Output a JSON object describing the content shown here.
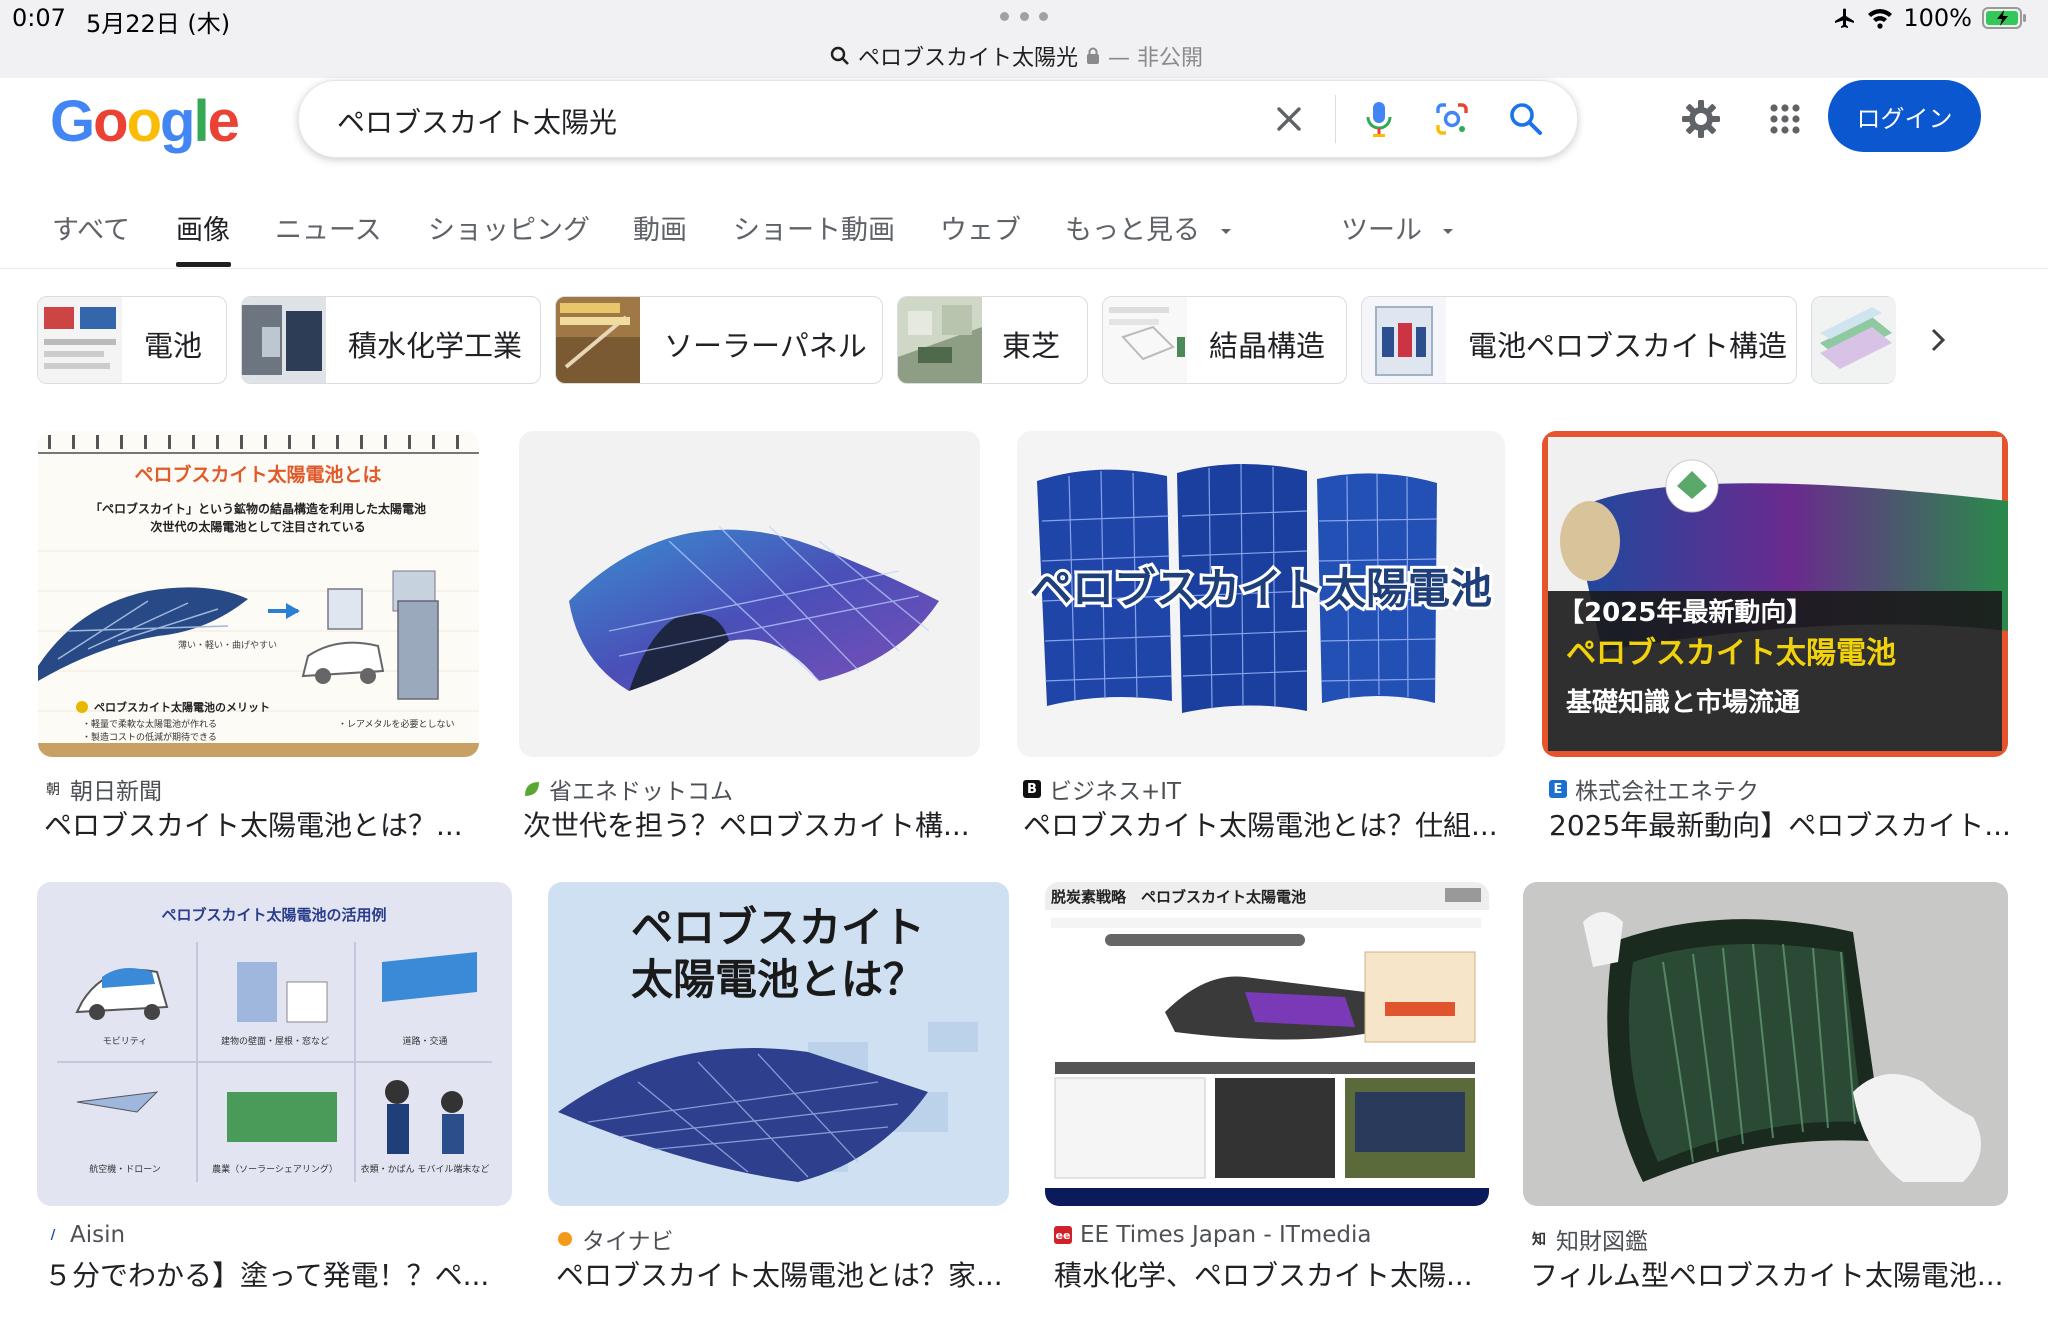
{
  "status_bar": {
    "time": "0:07",
    "date": "5月22日 (木)",
    "url_text": "ペロブスカイト太陽光",
    "private_label": "— 非公開",
    "battery": "100%"
  },
  "google": {
    "logo": "Google",
    "search_query": "ペロブスカイト太陽光",
    "login_label": "ログイン",
    "icons": [
      "clear-icon",
      "mic-icon",
      "lens-icon",
      "search-icon",
      "settings-icon",
      "apps-icon"
    ]
  },
  "tabs": [
    {
      "label": "すべて",
      "active": false
    },
    {
      "label": "画像",
      "active": true
    },
    {
      "label": "ニュース",
      "active": false
    },
    {
      "label": "ショッピング",
      "active": false
    },
    {
      "label": "動画",
      "active": false
    },
    {
      "label": "ショート動画",
      "active": false
    },
    {
      "label": "ウェブ",
      "active": false
    },
    {
      "label": "もっと見る",
      "active": false
    },
    {
      "label": "ツール",
      "active": false
    }
  ],
  "chips": [
    {
      "label": "電池"
    },
    {
      "label": "積水化学工業"
    },
    {
      "label": "ソーラーパネル"
    },
    {
      "label": "東芝"
    },
    {
      "label": "結晶構造"
    },
    {
      "label": "電池ペロブスカイト構造"
    }
  ],
  "results": [
    {
      "source": "朝日新聞",
      "title": "ペロブスカイト太陽電池とは？...",
      "image_text": {
        "heading": "ペロブスカイト太陽電池とは",
        "line1": "「ペロブスカイト」という鉱物の結晶構造を利用した太陽電池",
        "line2": "次世代の太陽電池として注目されている",
        "caption": "薄い・軽い・曲げやすい",
        "merit": "ペロブスカイト太陽電池のメリット",
        "merit1": "・軽量で柔軟な太陽電池が作れる",
        "merit2": "・レアメタルを必要としない",
        "merit3": "・製造コストの低減が期待できる"
      }
    },
    {
      "source": "省エネドットコム",
      "title": "次世代を担う？ペロブスカイト構..."
    },
    {
      "source": "ビジネス+IT",
      "title": "ペロブスカイト太陽電池とは？仕組...",
      "image_text": {
        "overlay": "ペロブスカイト太陽電池"
      }
    },
    {
      "source": "株式会社エネテク",
      "title": "2025年最新動向】ペロブスカイト...",
      "image_text": {
        "line1": "【2025年最新動向】",
        "line2": "ペロブスカイト太陽電池",
        "line3": "基礎知識と市場流通"
      }
    },
    {
      "source": "Aisin",
      "title": "５分でわかる】塗って発電！？ペ...",
      "image_text": {
        "heading": "ペロブスカイト太陽電池の活用例",
        "labels": [
          "モビリティ",
          "建物の壁面・屋根・窓など",
          "道路・交通",
          "航空機・ドローン",
          "農業（ソーラーシェアリング）",
          "衣類・かばん モバイル端末など"
        ]
      }
    },
    {
      "source": "タイナビ",
      "title": "ペロブスカイト太陽電池とは？家...",
      "image_text": {
        "line1": "ペロブスカイト",
        "line2": "太陽電池とは？"
      }
    },
    {
      "source": "EE Times Japan - ITmedia",
      "title": "積水化学、ペロブスカイト太陽...",
      "image_text": {
        "heading": "脱炭素戦略　ペロブスカイト太陽電池"
      }
    },
    {
      "source": "知財図鑑",
      "title": "フィルム型ペロブスカイト太陽電池..."
    }
  ]
}
